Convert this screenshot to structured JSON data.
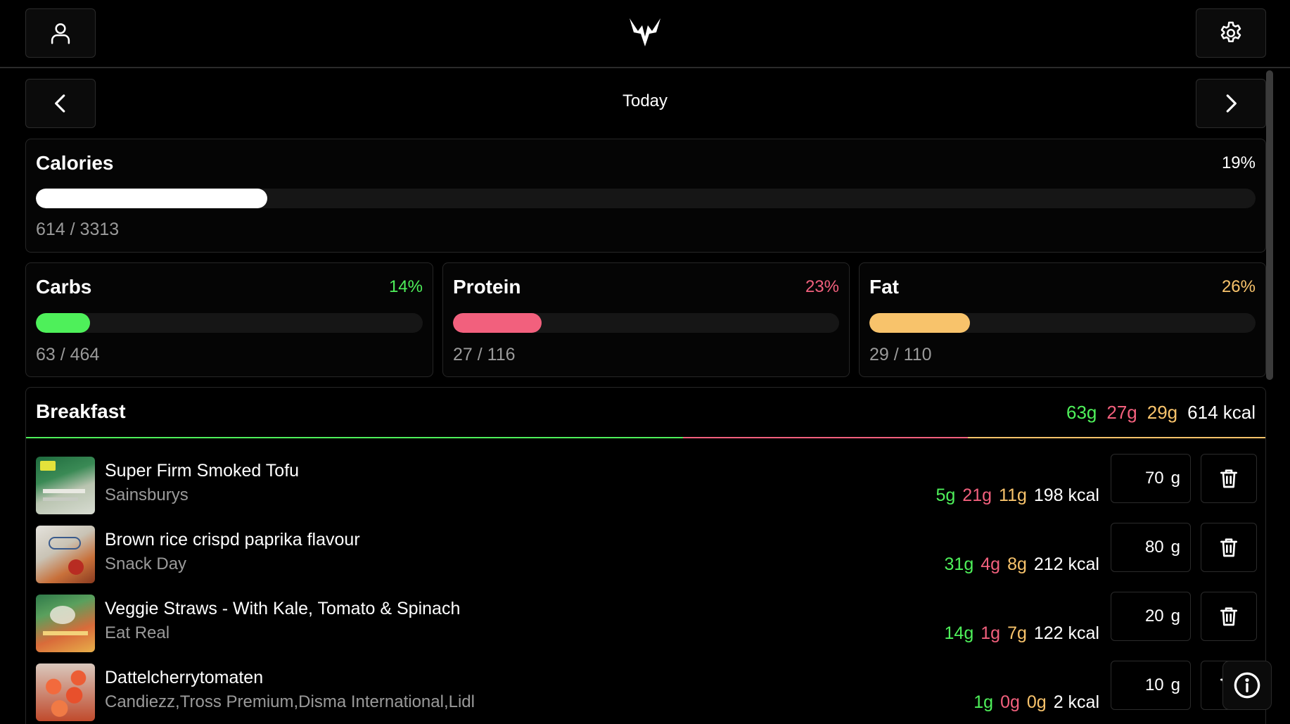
{
  "header": {
    "profile_icon": "user-icon",
    "logo_icon": "antlers-logo-icon",
    "settings_icon": "gear-icon"
  },
  "date_nav": {
    "prev_icon": "chevron-left-icon",
    "title": "Today",
    "next_icon": "chevron-right-icon"
  },
  "colors": {
    "carbs": "#4ef05a",
    "protein": "#f2607d",
    "fat": "#f8c36b",
    "calories": "#ffffff"
  },
  "summary": {
    "calories": {
      "label": "Calories",
      "percent_text": "19%",
      "fill_fraction": 0.19,
      "amount": "614 / 3313"
    },
    "carbs": {
      "label": "Carbs",
      "percent_text": "14%",
      "fill_fraction": 0.14,
      "amount": "63 / 464"
    },
    "protein": {
      "label": "Protein",
      "percent_text": "23%",
      "fill_fraction": 0.23,
      "amount": "27 / 116"
    },
    "fat": {
      "label": "Fat",
      "percent_text": "26%",
      "fill_fraction": 0.26,
      "amount": "29 / 110"
    }
  },
  "meal": {
    "title": "Breakfast",
    "totals": {
      "carbs": "63g",
      "protein": "27g",
      "fat": "29g",
      "kcal": "614 kcal"
    },
    "macro_split": {
      "carbs": 0.53,
      "protein": 0.23,
      "fat": 0.24
    },
    "items": [
      {
        "name": "Super Firm Smoked Tofu",
        "brand": "Sainsburys",
        "carbs": "5g",
        "protein": "21g",
        "fat": "11g",
        "kcal": "198 kcal",
        "qty": "70",
        "unit": "g"
      },
      {
        "name": "Brown rice crispd paprika flavour",
        "brand": "Snack Day",
        "carbs": "31g",
        "protein": "4g",
        "fat": "8g",
        "kcal": "212 kcal",
        "qty": "80",
        "unit": "g"
      },
      {
        "name": "Veggie Straws - With Kale, Tomato & Spinach",
        "brand": "Eat Real",
        "carbs": "14g",
        "protein": "1g",
        "fat": "7g",
        "kcal": "122 kcal",
        "qty": "20",
        "unit": "g"
      },
      {
        "name": "Dattelcherrytomaten",
        "brand": "Candiezz,Tross Premium,Disma International,Lidl",
        "carbs": "1g",
        "protein": "0g",
        "fat": "0g",
        "kcal": "2 kcal",
        "qty": "10",
        "unit": "g"
      }
    ]
  },
  "info_icon": "info-icon"
}
